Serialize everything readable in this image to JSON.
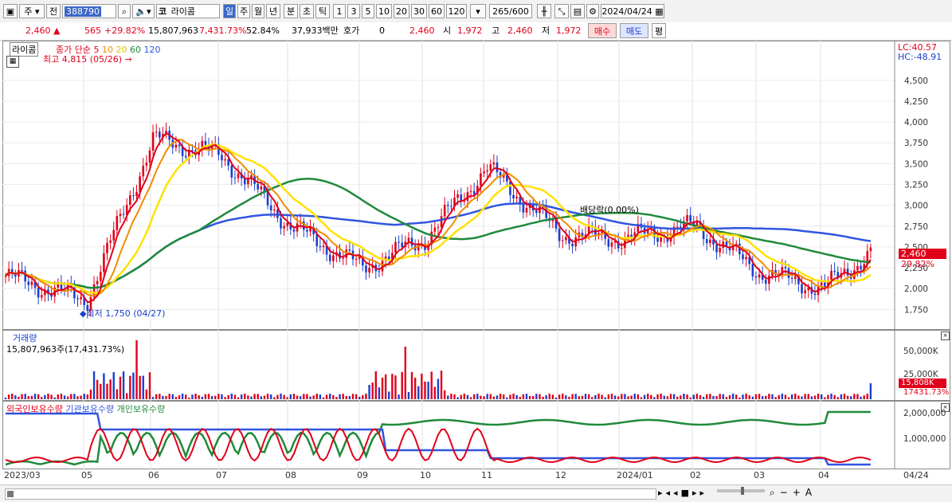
{
  "toolbar": {
    "market_label": "주",
    "prev_label": "전",
    "code_value": "388790",
    "name_prefix": "코",
    "name_value": "라이콤",
    "period_day": "일",
    "period_week": "주",
    "period_month": "월",
    "period_year": "년",
    "period_minute": "분",
    "period_second": "초",
    "period_tick": "틱",
    "intervals": [
      "1",
      "3",
      "5",
      "10",
      "20",
      "30",
      "60",
      "120"
    ],
    "bar_count": "265",
    "bar_total": "/600",
    "date_value": "2024/04/24"
  },
  "quote": {
    "price": "2,460",
    "change": "565",
    "change_pct": "+29.82%",
    "volume": "15,807,963",
    "volume_ratio": "7,431.73%",
    "turnover_ratio": "52.84%",
    "amount": "37,933백만",
    "hoga_label": "호가",
    "hoga_value": "0",
    "hoga_price": "2,460",
    "open_label": "시",
    "open_value": "1,972",
    "high_label": "고",
    "high_value": "2,460",
    "low_label": "저",
    "low_value": "1,972",
    "buy_label": "매수",
    "sell_label": "매도",
    "eval_label": "평"
  },
  "price_pane": {
    "name_tag": "라이콤",
    "legend": {
      "title": "종가 단순",
      "ma5": "5",
      "ma10": "10",
      "ma20": "20",
      "ma60": "60",
      "ma120": "120"
    },
    "high_note": "최고 4,815 (05/26)",
    "low_note": "최저 1,750 (04/27)",
    "dividend_note": "배당락(0.00%)",
    "lc_label": "LC:40.57",
    "hc_label": "HC:-48.91",
    "price_tag": "2,460",
    "pct_tag": "29.82%"
  },
  "volume_pane": {
    "title": "거래량",
    "value_label": "15,807,963주(17,431.73%)",
    "tag_value": "15,808K",
    "tag_pct": "17431.73%"
  },
  "holding_pane": {
    "foreign_label": "외국인보유수량",
    "inst_label": "기관보유수량",
    "retail_label": "개인보유수량"
  },
  "x_axis_labels": [
    "2023/03",
    "05",
    "06",
    "07",
    "08",
    "09",
    "10",
    "11",
    "12",
    "2024/01",
    "02",
    "03",
    "04",
    "04/24"
  ],
  "chart_data": [
    {
      "type": "candlestick",
      "title": "라이콤",
      "y_ticks": [
        1750,
        2000,
        2250,
        2500,
        2750,
        3000,
        3250,
        3500,
        3750,
        4000,
        4250,
        4500
      ],
      "ylim": [
        1600,
        4900
      ],
      "series": [
        {
          "name": "5",
          "color": "#e0001a"
        },
        {
          "name": "10",
          "color": "#f08c00"
        },
        {
          "name": "20",
          "color": "#ffe100"
        },
        {
          "name": "60",
          "color": "#1f8a3a"
        },
        {
          "name": "120",
          "color": "#2f55e0"
        }
      ],
      "close_path": {
        "months": [
          "2023/03",
          "05",
          "06",
          "07",
          "08",
          "09",
          "10",
          "11",
          "12",
          "2024/01",
          "02",
          "03",
          "04",
          "04/24"
        ],
        "close": [
          2150,
          1860,
          3800,
          3600,
          2750,
          2250,
          2600,
          3450,
          2650,
          2600,
          2750,
          2200,
          2000,
          2460
        ]
      },
      "extremes": {
        "high": 4815,
        "high_date": "05/26",
        "low": 1750,
        "low_date": "04/27"
      }
    },
    {
      "type": "bar",
      "title": "거래량",
      "y_ticks": [
        "25,000K",
        "50,000K"
      ],
      "last_value": "15,808K"
    },
    {
      "type": "line",
      "y_ticks": [
        "1,000,000",
        "2,000,000"
      ],
      "series": [
        {
          "name": "외국인보유수량",
          "color": "#e0001a"
        },
        {
          "name": "기관보유수량",
          "color": "#2f55e0"
        },
        {
          "name": "개인보유수량",
          "color": "#1f8a3a"
        }
      ]
    }
  ],
  "colors": {
    "up": "#e0001a",
    "down": "#1a3fd0",
    "accent": "#3b67c8"
  }
}
